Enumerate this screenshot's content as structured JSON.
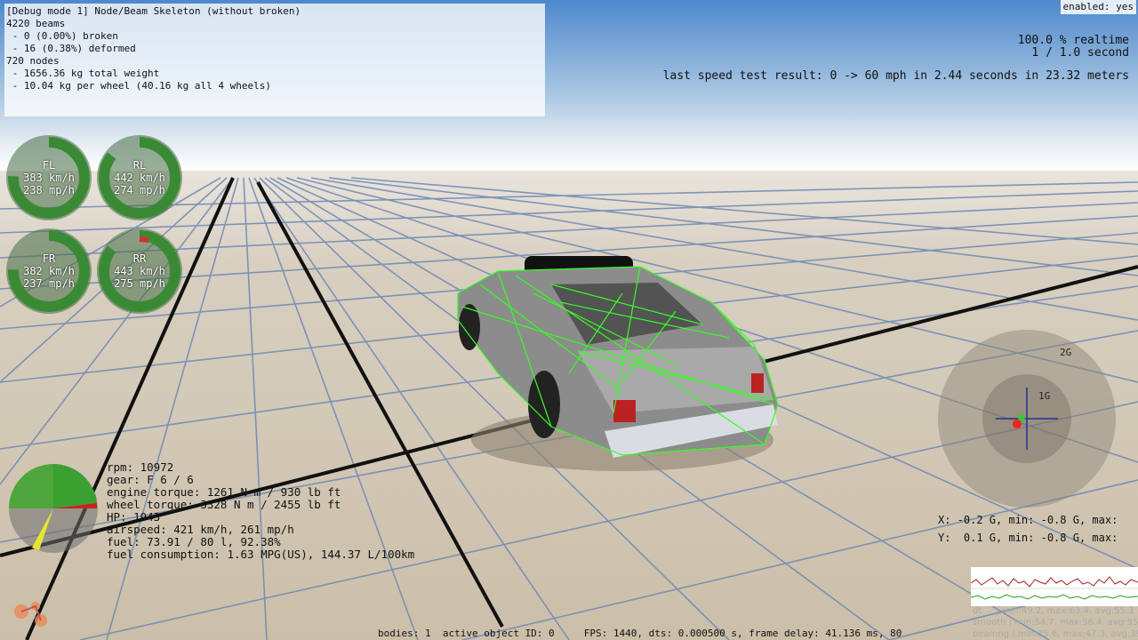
{
  "debug": {
    "mode_title": "[Debug mode 1] Node/Beam Skeleton (without broken)",
    "lines": [
      "",
      "4220 beams",
      " - 0 (0.00%) broken",
      " - 16 (0.38%) deformed",
      "720 nodes",
      " - 1656.36 kg total weight",
      " - 10.04 kg per wheel (40.16 kg all 4 wheels)"
    ]
  },
  "enabled": "enabled: yes",
  "realtime": {
    "line1": "100.0 % realtime",
    "line2": "1 / 1.0 second"
  },
  "speed_test": "last speed test result: 0 -> 60 mph in 2.44 seconds in 23.32 meters",
  "wheels": [
    {
      "id": "FL",
      "kmh": "383 km/h",
      "mph": "238 mp/h"
    },
    {
      "id": "RL",
      "kmh": "442 km/h",
      "mph": "274 mp/h"
    },
    {
      "id": "FR",
      "kmh": "382 km/h",
      "mph": "237 mp/h"
    },
    {
      "id": "RR",
      "kmh": "443 km/h",
      "mph": "275 mp/h"
    }
  ],
  "engine": {
    "lines": [
      "rpm: 10972",
      "gear: F 6 / 6",
      "engine torque: 1261 N m / 930 lb ft",
      "wheel torque: 3328 N m / 2455 lb ft",
      "HP: 1943",
      "airspeed: 421 km/h, 261 mp/h",
      "fuel: 73.91 / 80 l, 92.38%",
      "fuel consumption: 1.63 MPG(US), 144.37 L/100km"
    ]
  },
  "gforce": {
    "label_2g": "2G",
    "label_1g": "1G",
    "x_line": "X: -0.2 G, min: -0.8 G, max:",
    "y_line": "Y:  0.1 G, min: -0.8 G, max:"
  },
  "status_bar": "bodies: 1  active object ID: 0     FPS: 1440, dts: 0.000500 s, frame delay: 41.136 ms, 80",
  "graphs": {
    "dt": "dt     | min:49.2, max:63.4, avg:55.3",
    "smooth": "smooth | min:54.7, max:56.4, avg:55.3",
    "beamng": "beamng | min:35.6, max:47.3, avg:39.4"
  },
  "colors": {
    "wireframe": "#33ff22",
    "gauge": "#3a8a35",
    "sky": "#8fb3d8",
    "ground": "#d1c8b8"
  }
}
